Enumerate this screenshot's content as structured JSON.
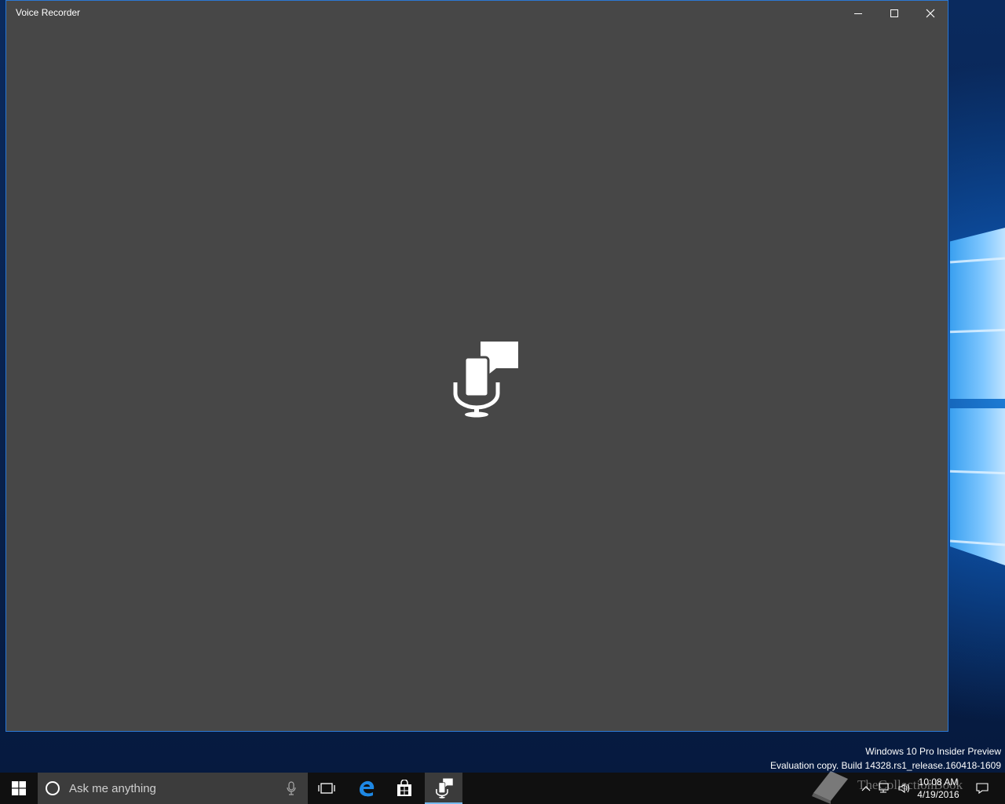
{
  "window": {
    "title": "Voice Recorder",
    "minimize_label": "",
    "maximize_label": "",
    "close_label": ""
  },
  "app": {
    "splash_icon": "voice-recorder-icon"
  },
  "watermark": {
    "line1": "Windows 10 Pro Insider Preview",
    "line2": "Evaluation copy. Build 14328.rs1_release.160418-1609"
  },
  "taskbar": {
    "search_placeholder": "Ask me anything",
    "clock_time": "10:08 AM",
    "clock_date": "4/19/2016",
    "pinned": [
      "task-view-icon",
      "edge-icon",
      "store-icon",
      "voice-recorder-icon"
    ]
  },
  "overlay": {
    "brand_text": "TheCollectionBook"
  },
  "colors": {
    "window_bg": "#474747",
    "window_border": "#2b78d4",
    "taskbar_bg": "#101010",
    "search_bg": "#3c3c3c",
    "accent": "#76b9ed"
  }
}
